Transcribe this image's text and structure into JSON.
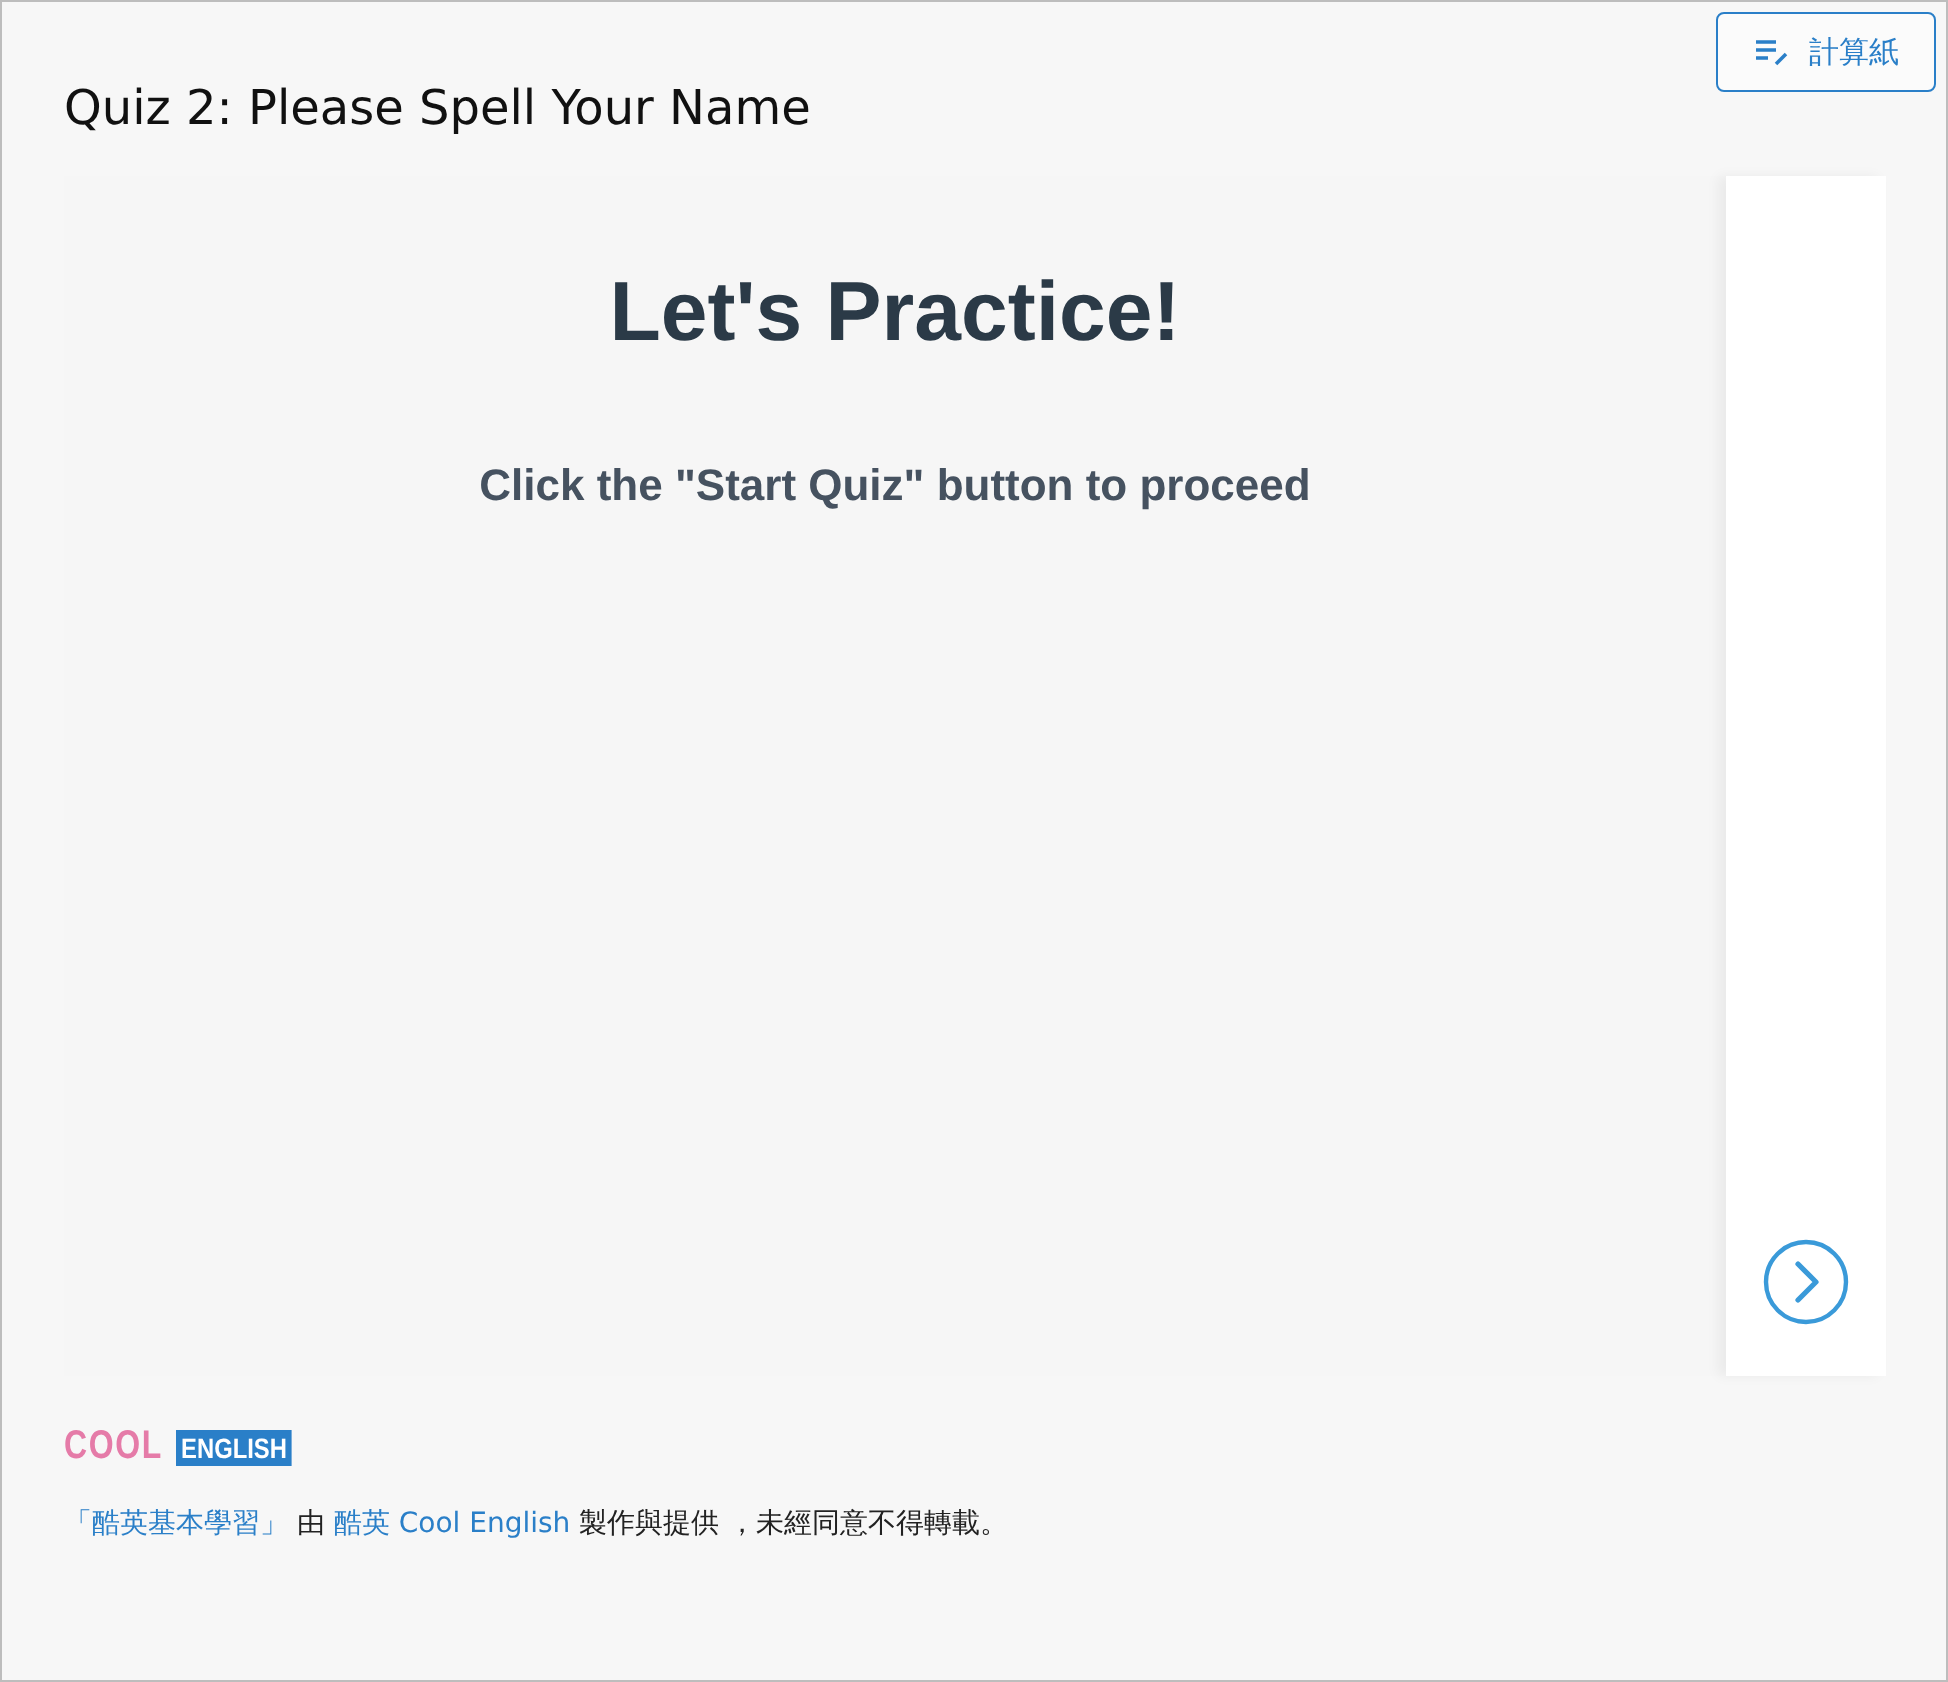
{
  "toolbar": {
    "scratch_button": "計算紙"
  },
  "title": "Quiz 2: Please Spell Your Name",
  "quiz": {
    "heading": "Let's Practice!",
    "instruction": "Click the \"Start Quiz\" button to proceed"
  },
  "footer": {
    "logo": {
      "left": "COOL",
      "right": "ENGLISH"
    },
    "credit": [
      {
        "kind": "link",
        "text": "「酷英基本學習」"
      },
      {
        "kind": "text",
        "text": " 由 "
      },
      {
        "kind": "link",
        "text": "酷英 Cool English"
      },
      {
        "kind": "text",
        "text": " 製作與提供 ，未經同意不得轉載。"
      }
    ]
  }
}
